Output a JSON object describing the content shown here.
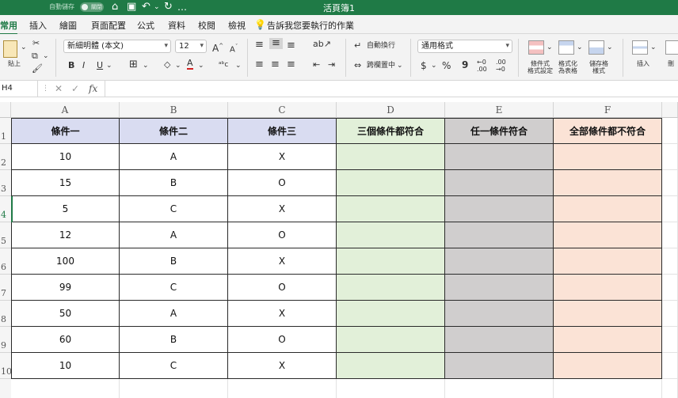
{
  "titlebar": {
    "title": "活頁簿1",
    "autosave_label": "自動儲存",
    "autosave_state": "關閉"
  },
  "tabs": [
    "常用",
    "插入",
    "繪圖",
    "頁面配置",
    "公式",
    "資料",
    "校閱",
    "檢視"
  ],
  "tell_me": "告訴我您要執行的作業",
  "ribbon": {
    "paste_label": "貼上",
    "font_name": "新細明體 (本文)",
    "font_size": "12",
    "bold": "B",
    "italic": "I",
    "underline": "U",
    "wrap_text": "自動換行",
    "merge_center": "跨欄置中",
    "number_format": "通用格式",
    "currency": "$",
    "percent": "%",
    "comma": "9",
    "conditional_format": "條件式\n格式設定",
    "format_as_table": "格式化\n為表格",
    "cell_styles": "儲存格\n樣式",
    "insert": "插入",
    "delete": "刪"
  },
  "formula_bar": {
    "name_box": "H4",
    "fx": "fx",
    "formula": ""
  },
  "colors": {
    "accent": "#1f7a46",
    "hdr_abc": "#d9dcf1",
    "col_d": "#e2f0d9",
    "col_e": "#d0cece",
    "col_f": "#fbe3d6"
  },
  "columns": [
    "A",
    "B",
    "C",
    "D",
    "E",
    "F"
  ],
  "rows": [
    "1",
    "2",
    "3",
    "4",
    "5",
    "6",
    "7",
    "8",
    "9",
    "10"
  ],
  "table": {
    "headers": [
      "條件一",
      "條件二",
      "條件三",
      "三個條件都符合",
      "任一條件符合",
      "全部條件都不符合"
    ],
    "data": [
      [
        "10",
        "A",
        "X"
      ],
      [
        "15",
        "B",
        "O"
      ],
      [
        "5",
        "C",
        "X"
      ],
      [
        "12",
        "A",
        "O"
      ],
      [
        "100",
        "B",
        "X"
      ],
      [
        "99",
        "C",
        "O"
      ],
      [
        "50",
        "A",
        "X"
      ],
      [
        "60",
        "B",
        "O"
      ],
      [
        "10",
        "C",
        "X"
      ]
    ]
  }
}
